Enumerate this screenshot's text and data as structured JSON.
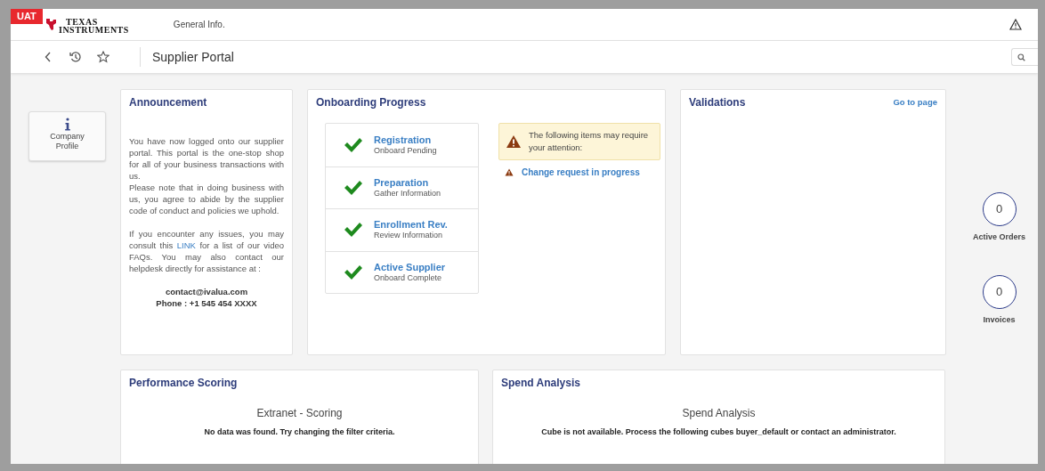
{
  "environment_badge": "UAT",
  "brand": {
    "line_1": "TEXAS",
    "line_2": "INSTRUMENTS"
  },
  "header": {
    "menu_item": "General Info."
  },
  "toolbar": {
    "title": "Supplier Portal"
  },
  "tiles": [
    {
      "label": "Company Profile"
    }
  ],
  "announcement": {
    "title": "Announcement",
    "paragraph_1": "You have now logged onto our supplier portal. This portal is the one-stop shop for all of your business transactions with us.",
    "paragraph_2": "Please note that in doing business with us, you agree to abide by the supplier code of conduct and policies we uphold.",
    "paragraph_3_before": "If you encounter any issues, you may consult this",
    "link": "LINK",
    "paragraph_3_after": "for a list of our video FAQs. You may also contact our helpdesk directly for assistance at :",
    "email": "contact@ivalua.com",
    "phone": "Phone : +1 545 454 XXXX"
  },
  "onboarding": {
    "title": "Onboarding Progress",
    "steps": [
      {
        "title": "Registration",
        "subtitle": "Onboard Pending",
        "completed": true
      },
      {
        "title": "Preparation",
        "subtitle": "Gather Information",
        "completed": true
      },
      {
        "title": "Enrollment Rev.",
        "subtitle": "Review Information",
        "completed": true
      },
      {
        "title": "Active Supplier",
        "subtitle": "Onboard Complete",
        "completed": true
      }
    ],
    "alert": "The following items may require your attention:",
    "alert_items": [
      {
        "label": "Change request in progress"
      }
    ]
  },
  "validations": {
    "title": "Validations",
    "link": "Go to page"
  },
  "counters": [
    {
      "value": "0",
      "label": "Active Orders"
    },
    {
      "value": "0",
      "label": "Invoices"
    }
  ],
  "bottom_cards": [
    {
      "title": "Performance Scoring",
      "heading": "Extranet - Scoring",
      "message": "No data was found. Try changing the filter criteria."
    },
    {
      "title": "Spend Analysis",
      "heading": "Spend Analysis",
      "message": "Cube is not available. Process the following cubes buyer_default or contact an administrator."
    }
  ]
}
